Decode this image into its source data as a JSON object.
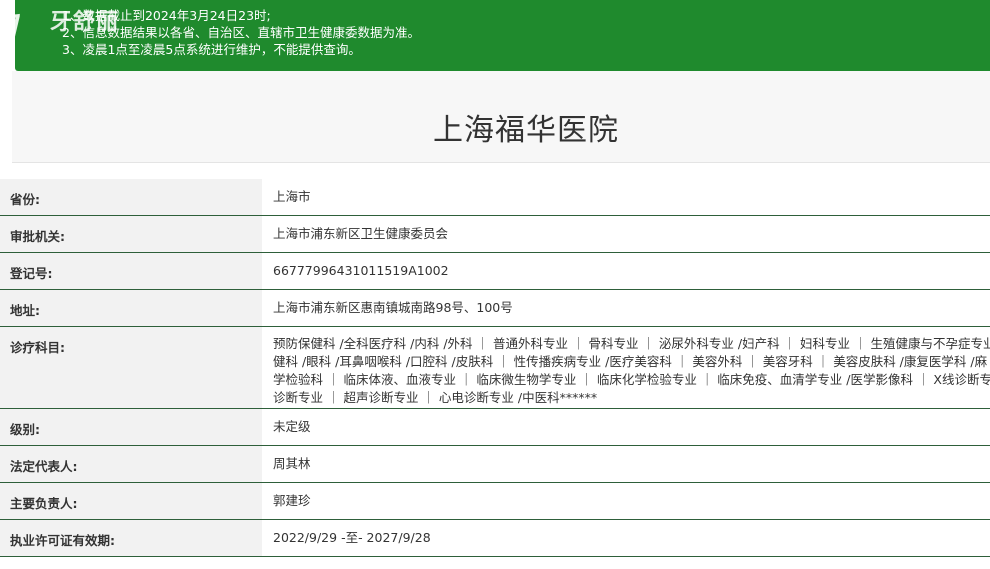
{
  "notice": {
    "lines": [
      "1、数据截止到2024年3月24日23时;",
      "2、信息数据结果以各省、自治区、直辖市卫生健康委数据为准。",
      "3、凌晨1点至凌晨5点系统进行维护，不能提供查询。"
    ]
  },
  "watermark": {
    "text": "牙舒丽"
  },
  "page_title": "上海福华医院",
  "fields": [
    {
      "label": "省份:",
      "value": "上海市"
    },
    {
      "label": "审批机关:",
      "value": "上海市浦东新区卫生健康委员会"
    },
    {
      "label": "登记号:",
      "value": "66777996431011519A1002"
    },
    {
      "label": "地址:",
      "value": "上海市浦东新区惠南镇城南路98号、100号"
    },
    {
      "label": "诊疗科目:",
      "value_lines": [
        "预防保健科 /全科医疗科 /内科 /外科 ｜ 普通外科专业 ｜ 骨科专业 ｜ 泌尿外科专业 /妇产科 ｜ 妇科专业 ｜ 生殖健康与不孕症专业",
        "健科 /眼科 /耳鼻咽喉科 /口腔科 /皮肤科 ｜ 性传播疾病专业 /医疗美容科 ｜ 美容外科 ｜ 美容牙科 ｜ 美容皮肤科 /康复医学科 /麻",
        "学检验科 ｜ 临床体液、血液专业 ｜ 临床微生物学专业 ｜ 临床化学检验专业 ｜ 临床免疫、血清学专业 /医学影像科 ｜ X线诊断专",
        "诊断专业 ｜ 超声诊断专业 ｜ 心电诊断专业 /中医科******"
      ]
    },
    {
      "label": "级别:",
      "value": "未定级"
    },
    {
      "label": "法定代表人:",
      "value": "周其林"
    },
    {
      "label": "主要负责人:",
      "value": "郭建珍"
    },
    {
      "label": "执业许可证有效期:",
      "value": "2022/9/29 -至- 2027/9/28"
    }
  ]
}
